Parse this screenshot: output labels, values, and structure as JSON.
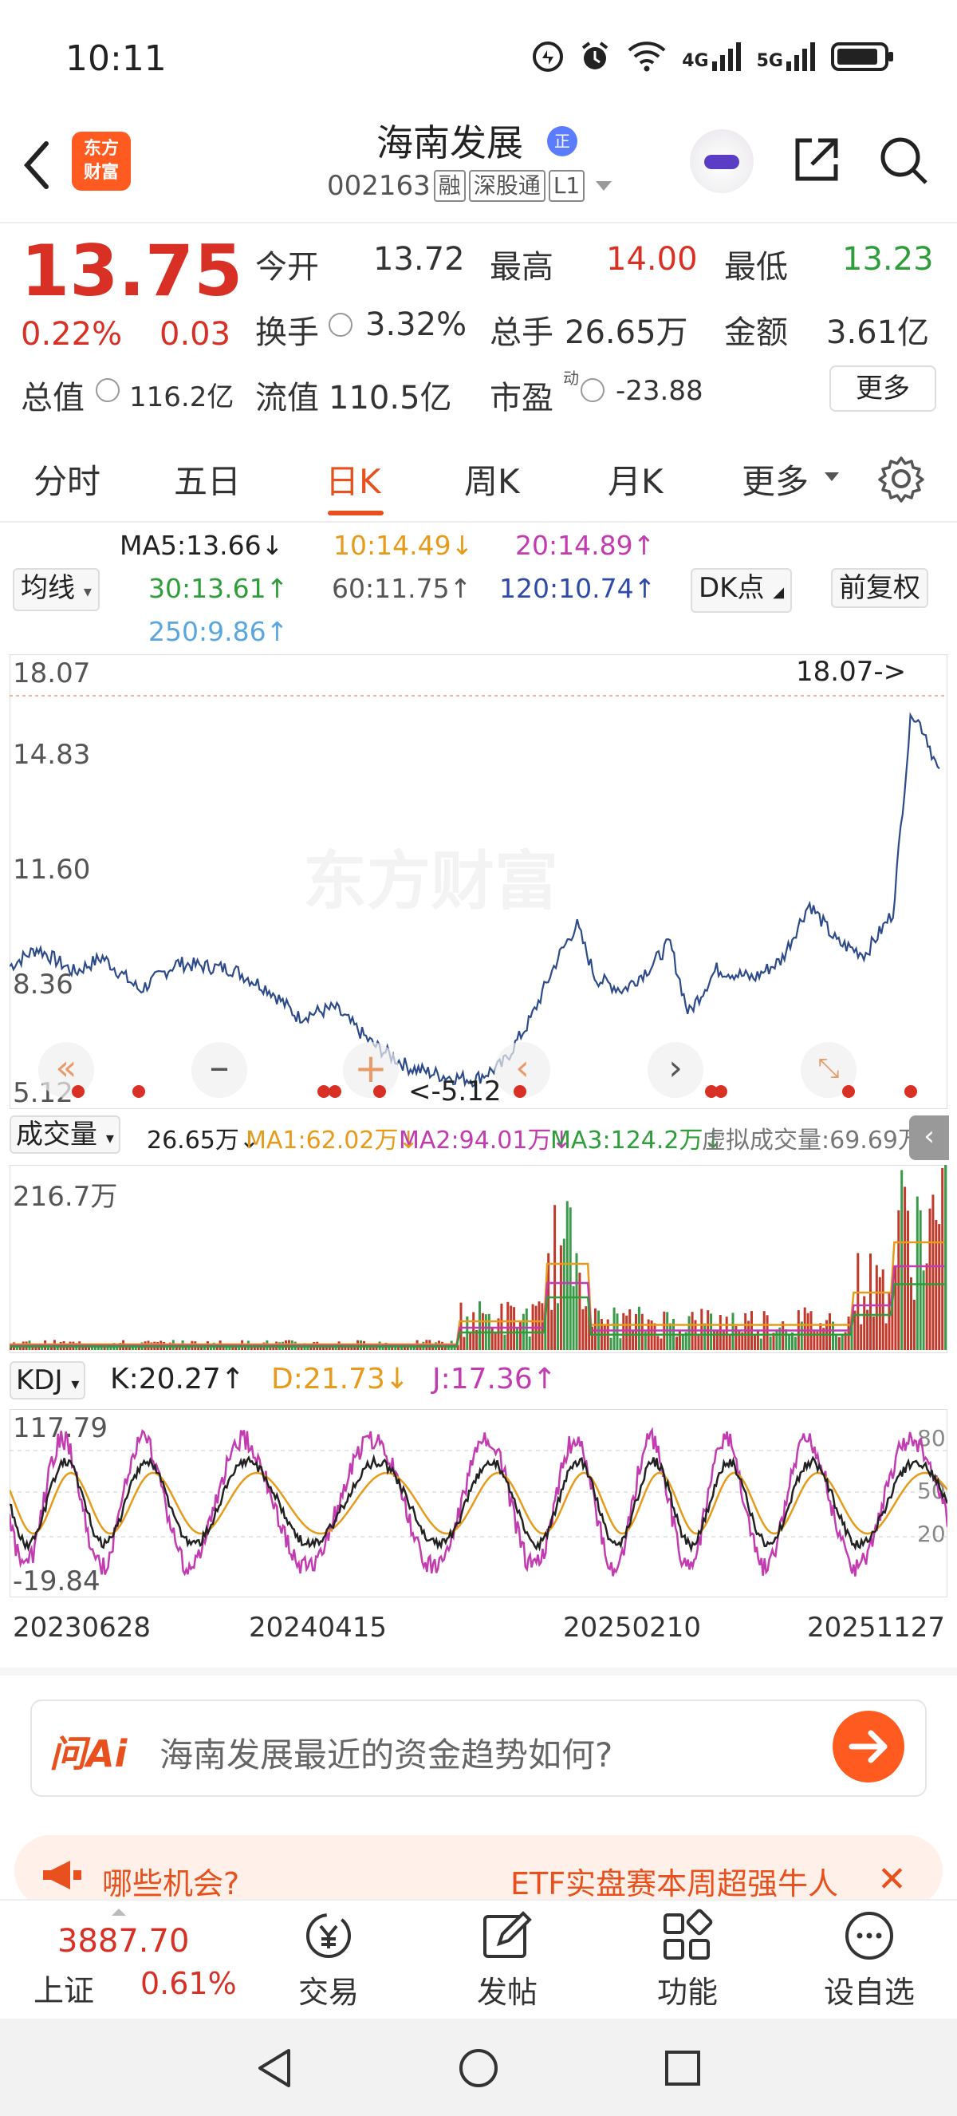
{
  "status": {
    "time": "10:11",
    "icons": [
      "data-icon",
      "alarm-icon",
      "wifi-icon",
      "4g-signal-icon",
      "5g-signal-icon",
      "battery-icon"
    ],
    "signal1": "4G",
    "signal2": "5G"
  },
  "header": {
    "logo_line1": "东方",
    "logo_line2": "财富",
    "name": "海南发展",
    "badge": "正",
    "code": "002163",
    "tags": [
      "融",
      "深股通",
      "L1"
    ]
  },
  "quote": {
    "price": "13.75",
    "change_pct": "0.22%",
    "change_amt": "0.03",
    "open_label": "今开",
    "open": "13.72",
    "high_label": "最高",
    "high": "14.00",
    "low_label": "最低",
    "low": "13.23",
    "turnover_label": "换手",
    "turnover": "3.32%",
    "volume_label": "总手",
    "volume": "26.65万",
    "amount_label": "金额",
    "amount": "3.61亿",
    "mcap_label": "总值",
    "mcap": "116.2亿",
    "float_label": "流值",
    "float": "110.5亿",
    "pe_label": "市盈",
    "pe_sup": "动",
    "pe": "-23.88",
    "more": "更多"
  },
  "tabs": [
    "分时",
    "五日",
    "日K",
    "周K",
    "月K",
    "更多"
  ],
  "active_tab": "日K",
  "ma": {
    "btn": "均线",
    "ma5": "MA5:13.66↓",
    "ma10": "10:14.49↓",
    "ma20": "20:14.89↑",
    "ma30": "30:13.61↑",
    "ma60": "60:11.75↑",
    "ma120": "120:10.74↑",
    "ma250": "250:9.86↑",
    "dk": "DK点",
    "fq": "前复权"
  },
  "chart": {
    "y_labels": [
      "18.07",
      "14.83",
      "11.60",
      "8.36",
      "5.12"
    ],
    "max_marker": "18.07->",
    "min_marker": "<-5.12",
    "watermark": "东方财富",
    "vol_btn": "成交量",
    "vol": "26.65万↓",
    "vol_ma1": "MA1:62.02万↓",
    "vol_ma2": "MA2:94.01万↓",
    "vol_ma3": "MA3:124.2万↓",
    "vol_virtual": "虚拟成交量:69.69万",
    "vol_max": "216.7万",
    "kdj_btn": "KDJ",
    "k": "K:20.27↑",
    "d": "D:21.73↓",
    "j": "J:17.36↑",
    "kdj_top": "117.79",
    "kdj_bottom": "-19.84",
    "kdj_r1": "80",
    "kdj_r2": "50",
    "kdj_r3": "20",
    "dates": [
      "20230628",
      "20240415",
      "20250210",
      "20251127"
    ]
  },
  "ai": {
    "logo": "问Ai",
    "text": "海南发展最近的资金趋势如何?"
  },
  "promo": {
    "left": "哪些机会?",
    "right": "ETF实盘赛本周超强牛人"
  },
  "nav": {
    "index_value": "3887.70",
    "index_name": "上证",
    "index_pct": "0.61%",
    "trade": "交易",
    "post": "发帖",
    "func": "功能",
    "watch": "设自选"
  },
  "colors": {
    "up": "#d93025",
    "down": "#2e9d3a",
    "accent": "#e8501e",
    "price_line": "#2d4a8a"
  }
}
